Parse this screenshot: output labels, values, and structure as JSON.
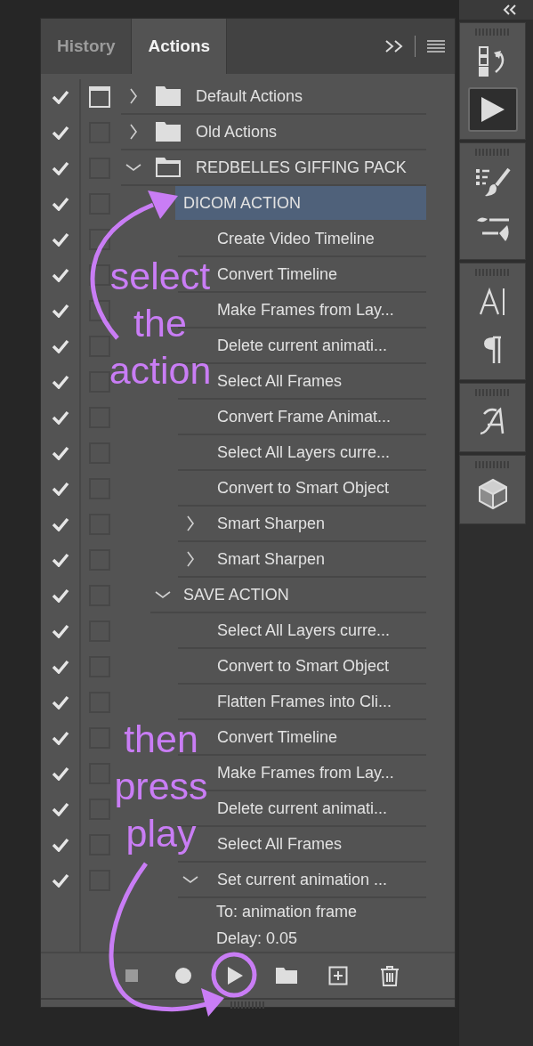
{
  "tabs": [
    {
      "label": "History",
      "selected": false
    },
    {
      "label": "Actions",
      "selected": true
    }
  ],
  "sets": [
    {
      "name": "Default Actions",
      "enabled": true,
      "dialog": true,
      "kind": "collapsed",
      "selected": false
    },
    {
      "name": "Old Actions",
      "enabled": true,
      "dialog": false,
      "kind": "collapsed",
      "selected": false
    },
    {
      "name": "REDBELLES GIFFING PACK",
      "enabled": true,
      "dialog": false,
      "kind": "expanded",
      "selected": false,
      "children": [
        {
          "name": "DICOM ACTION",
          "enabled": true,
          "dialog": false,
          "kind": "plain",
          "selected": true,
          "children": [
            {
              "name": "Create Video Timeline",
              "enabled": true,
              "dialog": false,
              "kind": "plain",
              "selected": false
            },
            {
              "name": "Convert Timeline",
              "enabled": true,
              "dialog": false,
              "kind": "plain",
              "selected": false
            },
            {
              "name": "Make Frames from Lay...",
              "enabled": true,
              "dialog": false,
              "kind": "plain",
              "selected": false
            },
            {
              "name": "Delete current animati...",
              "enabled": true,
              "dialog": false,
              "kind": "plain",
              "selected": false
            },
            {
              "name": "Select All Frames",
              "enabled": true,
              "dialog": false,
              "kind": "plain",
              "selected": false
            },
            {
              "name": "Convert Frame Animat...",
              "enabled": true,
              "dialog": false,
              "kind": "plain",
              "selected": false
            },
            {
              "name": "Select All Layers curre...",
              "enabled": true,
              "dialog": false,
              "kind": "plain",
              "selected": false
            },
            {
              "name": "Convert to Smart Object",
              "enabled": true,
              "dialog": false,
              "kind": "plain",
              "selected": false
            },
            {
              "name": "Smart Sharpen",
              "enabled": true,
              "dialog": false,
              "kind": "collapsed",
              "selected": false
            },
            {
              "name": "Smart Sharpen",
              "enabled": true,
              "dialog": false,
              "kind": "collapsed",
              "selected": false
            }
          ]
        },
        {
          "name": "SAVE ACTION",
          "enabled": true,
          "dialog": false,
          "kind": "expanded",
          "selected": false,
          "children": [
            {
              "name": "Select All Layers curre...",
              "enabled": true,
              "dialog": false,
              "kind": "plain",
              "selected": false
            },
            {
              "name": "Convert to Smart Object",
              "enabled": true,
              "dialog": false,
              "kind": "plain",
              "selected": false
            },
            {
              "name": "Flatten Frames into Cli...",
              "enabled": true,
              "dialog": false,
              "kind": "plain",
              "selected": false
            },
            {
              "name": "Convert Timeline",
              "enabled": true,
              "dialog": false,
              "kind": "plain",
              "selected": false
            },
            {
              "name": "Make Frames from Lay...",
              "enabled": true,
              "dialog": false,
              "kind": "plain",
              "selected": false
            },
            {
              "name": "Delete current animati...",
              "enabled": true,
              "dialog": false,
              "kind": "plain",
              "selected": false
            },
            {
              "name": "Select All Frames",
              "enabled": true,
              "dialog": false,
              "kind": "plain",
              "selected": false
            },
            {
              "name": "Set current animation ...",
              "enabled": true,
              "dialog": false,
              "kind": "expanded",
              "selected": false,
              "details": [
                "To: animation frame",
                "Delay: 0.05"
              ]
            }
          ]
        }
      ]
    }
  ],
  "toolbar": [
    {
      "kind": "stop",
      "disabled": true
    },
    {
      "kind": "record",
      "disabled": false
    },
    {
      "kind": "play",
      "disabled": false
    },
    {
      "kind": "new-set",
      "disabled": false
    },
    {
      "kind": "new-action",
      "disabled": false
    },
    {
      "kind": "delete",
      "disabled": false
    }
  ],
  "dock": [
    {
      "items": [
        {
          "kind": "history",
          "selected": false
        },
        {
          "kind": "actions",
          "selected": true
        }
      ]
    },
    {
      "items": [
        {
          "kind": "brush-presets",
          "selected": false
        },
        {
          "kind": "brush-settings",
          "selected": false
        }
      ]
    },
    {
      "items": [
        {
          "kind": "character",
          "selected": false
        },
        {
          "kind": "paragraph",
          "selected": false
        }
      ]
    },
    {
      "items": [
        {
          "kind": "glyphs",
          "selected": false
        }
      ]
    },
    {
      "items": [
        {
          "kind": "cube",
          "selected": false
        }
      ]
    }
  ],
  "annotations": [
    {
      "text": "select the action"
    },
    {
      "text": "then press play"
    }
  ]
}
